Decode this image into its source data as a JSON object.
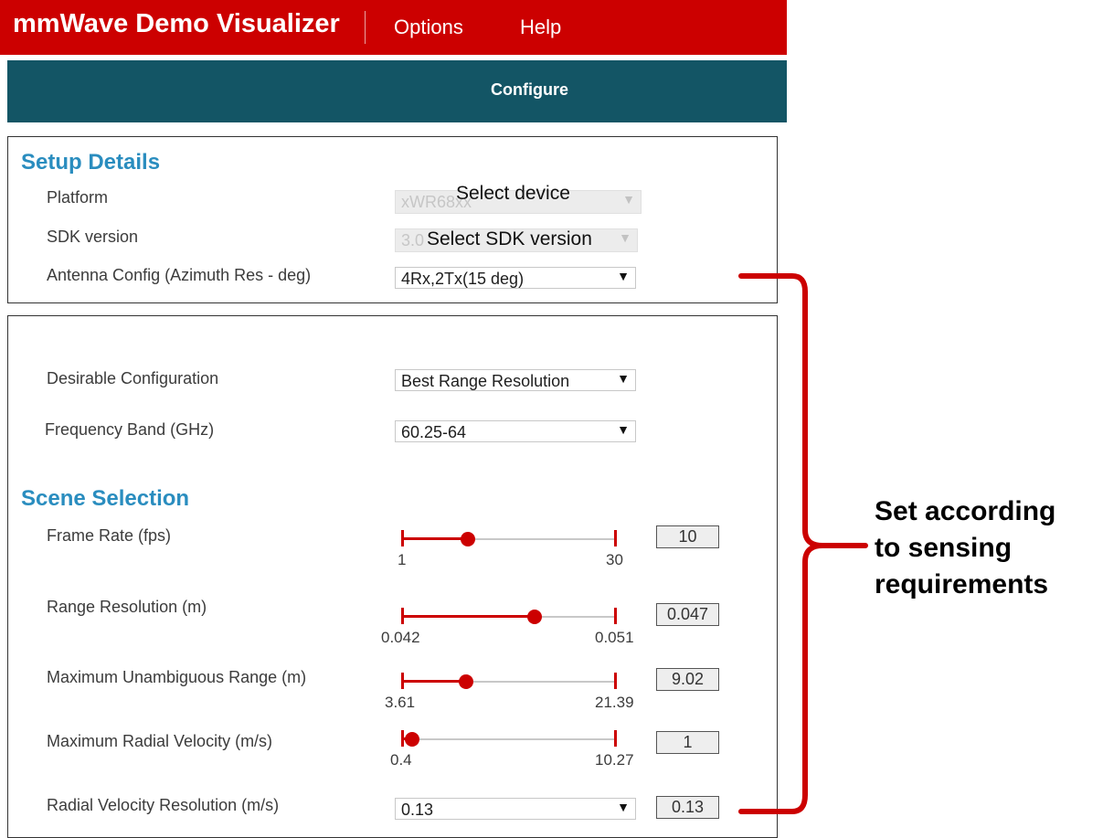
{
  "header": {
    "title": "mmWave Demo Visualizer",
    "menu": {
      "options": "Options",
      "help": "Help"
    },
    "brand_color": "#cc0000"
  },
  "tabs": {
    "configure": "Configure"
  },
  "setup": {
    "title": "Setup Details",
    "platform_label": "Platform",
    "platform_value": "xWR68xx",
    "platform_overlay": "Select device",
    "sdk_label": "SDK version",
    "sdk_value": "3.0",
    "sdk_overlay": "Select SDK version",
    "antenna_label": "Antenna Config (Azimuth Res - deg)",
    "antenna_value": "4Rx,2Tx(15 deg)"
  },
  "config": {
    "desirable_label": "Desirable Configuration",
    "desirable_value": "Best Range Resolution",
    "band_label": "Frequency Band (GHz)",
    "band_value": "60.25-64"
  },
  "scene": {
    "title": "Scene Selection",
    "sliders": [
      {
        "label": "Frame Rate (fps)",
        "min": "1",
        "max": "30",
        "value": "10",
        "fraction": 0.31
      },
      {
        "label": "Range Resolution (m)",
        "min": "0.042",
        "max": "0.051",
        "value": "0.047",
        "fraction": 0.62
      },
      {
        "label": "Maximum Unambiguous Range (m)",
        "min": "3.61",
        "max": "21.39",
        "value": "9.02",
        "fraction": 0.3
      },
      {
        "label": "Maximum Radial Velocity (m/s)",
        "min": "0.4",
        "max": "10.27",
        "value": "1",
        "fraction": 0.05
      }
    ],
    "velocity_res_label": "Radial Velocity Resolution (m/s)",
    "velocity_res_value": "0.13",
    "velocity_res_box": "0.13"
  },
  "annotation": {
    "lines": [
      "Set according",
      "to sensing",
      "requirements"
    ],
    "color": "#cc0000"
  }
}
